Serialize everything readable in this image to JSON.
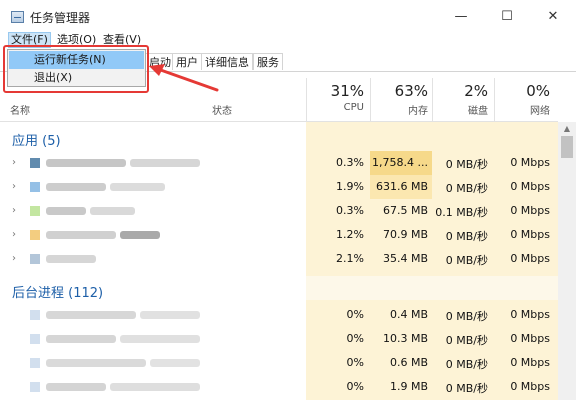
{
  "window": {
    "title": "任务管理器",
    "controls": {
      "minimize": "—",
      "maximize": "☐",
      "close": "✕"
    }
  },
  "menu": {
    "file": "文件(F)",
    "options": "选项(O)",
    "view": "查看(V)"
  },
  "file_menu": {
    "items": [
      {
        "label": "运行新任务(N)"
      },
      {
        "label": "退出(X)"
      }
    ]
  },
  "tabs": [
    "启动",
    "用户",
    "详细信息",
    "服务"
  ],
  "columns": {
    "name": "名称",
    "status": "状态",
    "cpu": {
      "pct": "31%",
      "label": "CPU"
    },
    "memory": {
      "pct": "63%",
      "label": "内存"
    },
    "disk": {
      "pct": "2%",
      "label": "磁盘"
    },
    "network": {
      "pct": "0%",
      "label": "网络"
    }
  },
  "sections": {
    "apps": "应用 (5)",
    "background": "后台进程 (112)"
  },
  "apps": [
    {
      "cpu": "0.3%",
      "mem": "1,758.4 ...",
      "disk": "0 MB/秒",
      "net": "0 Mbps"
    },
    {
      "cpu": "1.9%",
      "mem": "631.6 MB",
      "disk": "0 MB/秒",
      "net": "0 Mbps"
    },
    {
      "cpu": "0.3%",
      "mem": "67.5 MB",
      "disk": "0.1 MB/秒",
      "net": "0 Mbps"
    },
    {
      "cpu": "1.2%",
      "mem": "70.9 MB",
      "disk": "0 MB/秒",
      "net": "0 Mbps"
    },
    {
      "cpu": "2.1%",
      "mem": "35.4 MB",
      "disk": "0 MB/秒",
      "net": "0 Mbps"
    }
  ],
  "background": [
    {
      "cpu": "0%",
      "mem": "0.4 MB",
      "disk": "0 MB/秒",
      "net": "0 Mbps"
    },
    {
      "cpu": "0%",
      "mem": "10.3 MB",
      "disk": "0 MB/秒",
      "net": "0 Mbps"
    },
    {
      "cpu": "0%",
      "mem": "0.6 MB",
      "disk": "0 MB/秒",
      "net": "0 Mbps"
    },
    {
      "cpu": "0%",
      "mem": "1.9 MB",
      "disk": "0 MB/秒",
      "net": "0 Mbps"
    }
  ],
  "colors": {
    "highlight_light": "#fdf3d6",
    "highlight_mem": "#f6d98a",
    "highlight_mid": "#fbe7b0",
    "accent_blue": "#1d5fa8",
    "annotation_red": "#e53935"
  },
  "icons": {
    "app": "task-manager-icon",
    "expand": "chevron-right-icon",
    "arrow": "annotation-arrow-icon"
  }
}
